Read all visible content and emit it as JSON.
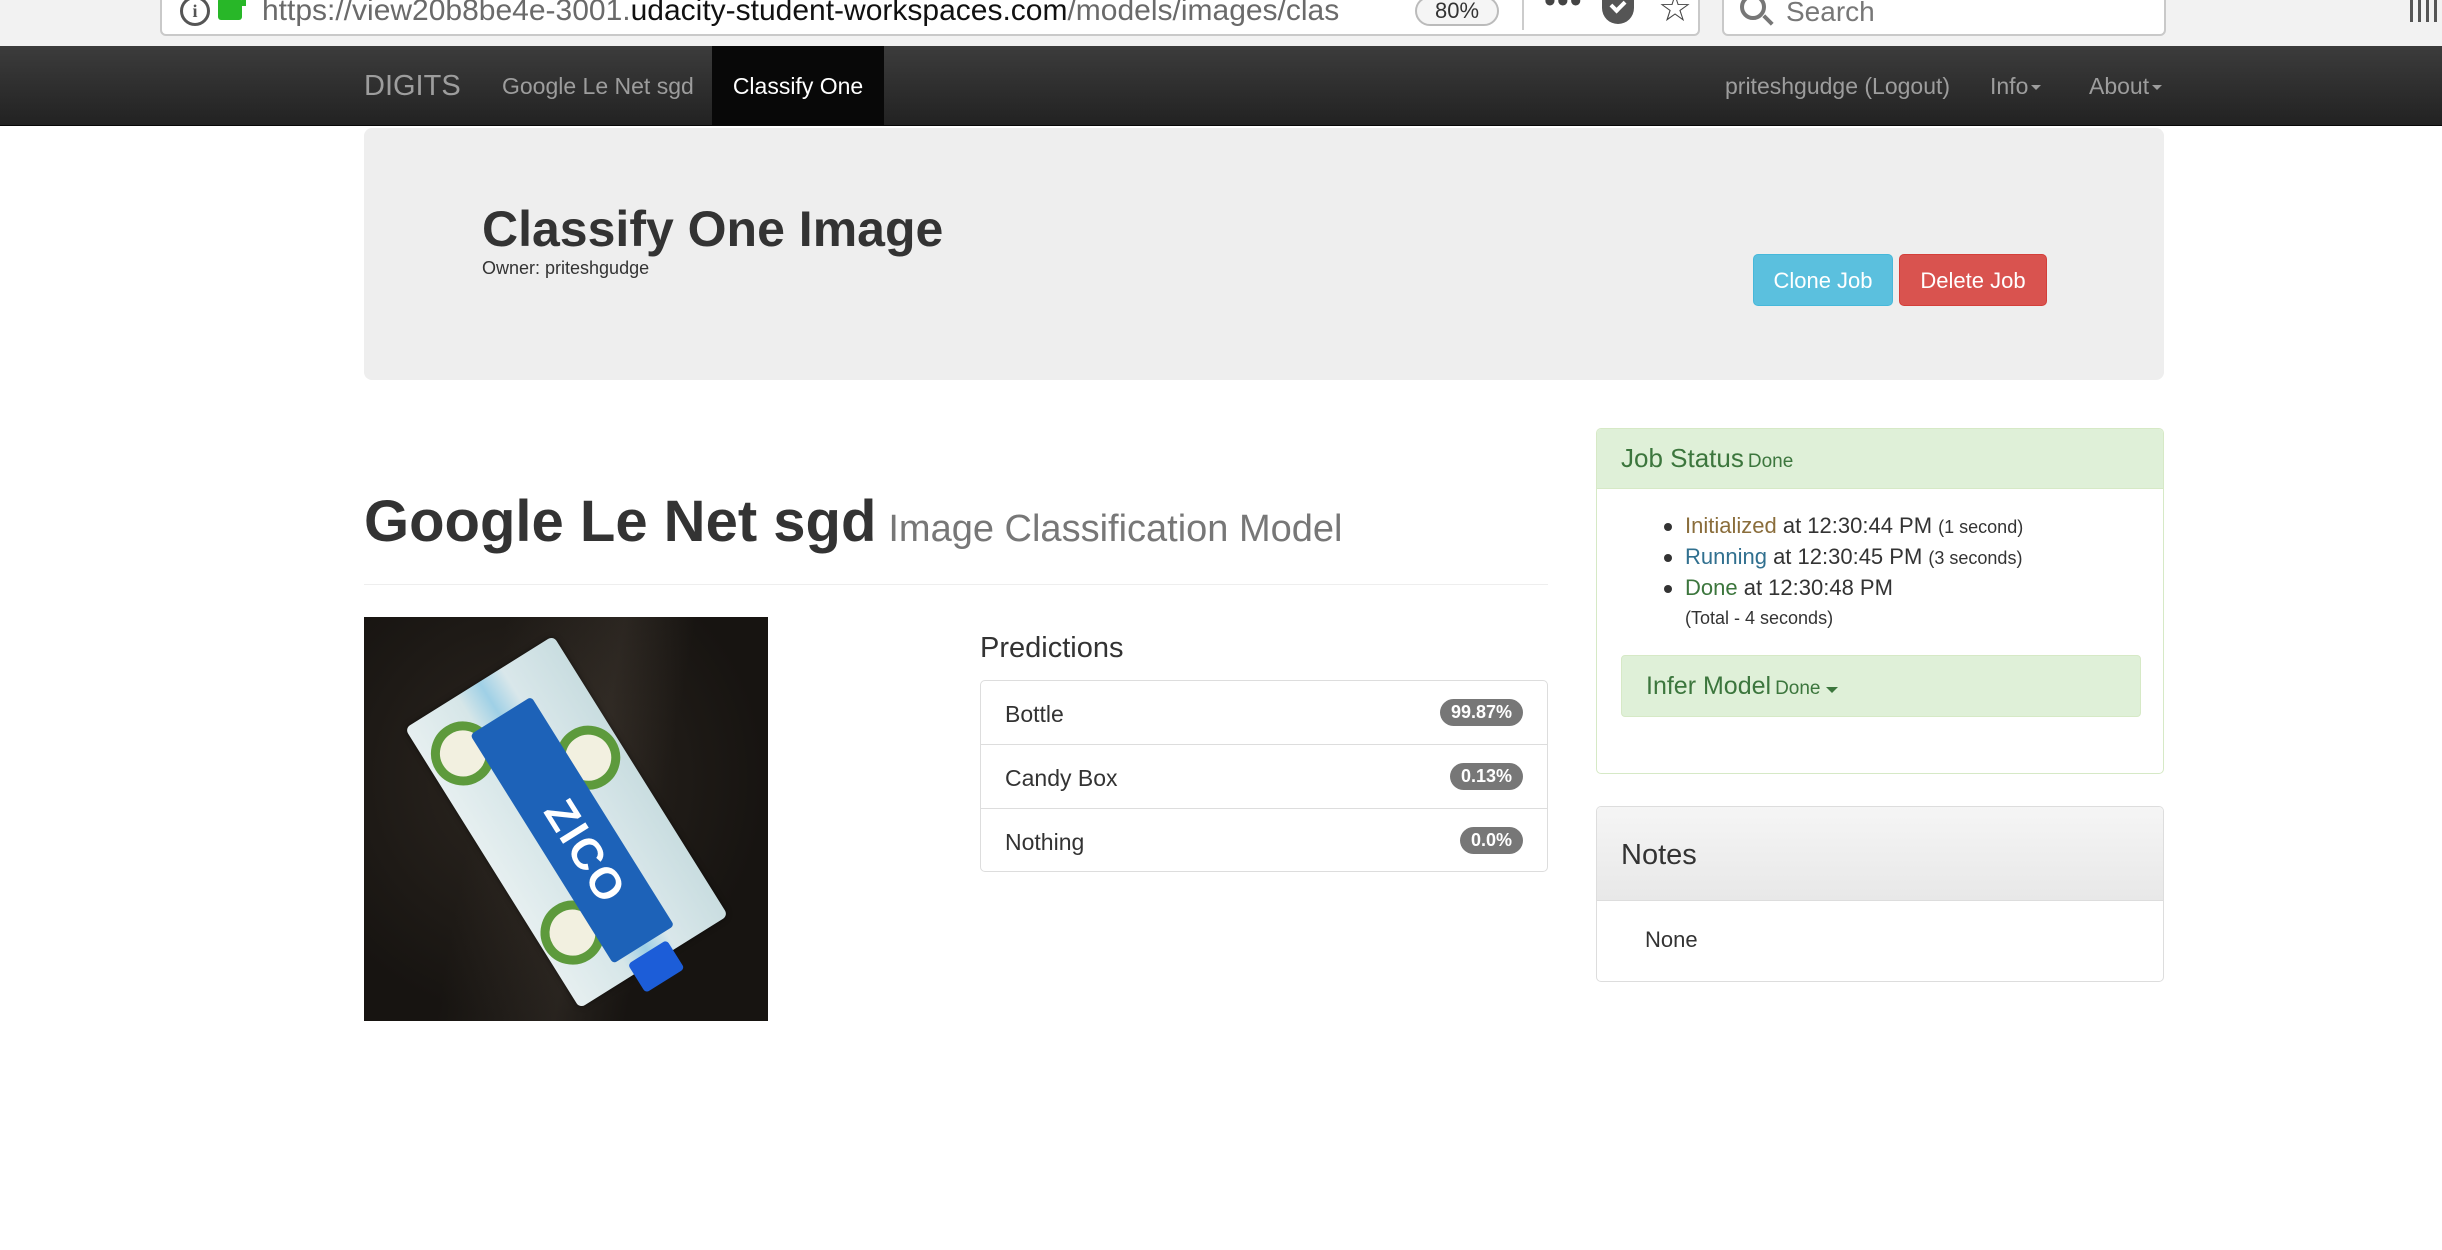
{
  "browser": {
    "url_prefix": "https://view20b8be4e-3001.",
    "url_domain": "udacity-student-workspaces.com",
    "url_path": "/models/images/clas",
    "zoom": "80%",
    "search_placeholder": "Search",
    "icons": [
      "info-icon",
      "lock-icon",
      "dots-icon",
      "pocket-icon",
      "star-icon",
      "search-icon",
      "library-icon"
    ]
  },
  "navbar": {
    "brand": "DIGITS",
    "left_items": [
      "Google Le Net sgd",
      "Classify One"
    ],
    "active": "Classify One",
    "user_logout": "priteshgudge (Logout)",
    "info": "Info",
    "about": "About"
  },
  "header": {
    "title": "Classify One Image",
    "owner": "Owner: priteshgudge",
    "clone_label": "Clone Job",
    "delete_label": "Delete Job"
  },
  "model": {
    "name": "Google Le Net sgd",
    "subtitle": "Image Classification Model"
  },
  "image": {
    "label_text": "ZICO"
  },
  "predictions": {
    "title": "Predictions",
    "rows": [
      {
        "label": "Bottle",
        "value": "99.87%"
      },
      {
        "label": "Candy Box",
        "value": "0.13%"
      },
      {
        "label": "Nothing",
        "value": "0.0%"
      }
    ]
  },
  "job_status": {
    "title": "Job Status",
    "state": "Done",
    "steps": [
      {
        "name": "Initialized",
        "time": " at 12:30:44 PM ",
        "duration": "(1 second)"
      },
      {
        "name": "Running",
        "time": " at 12:30:45 PM ",
        "duration": "(3 seconds)"
      },
      {
        "name": "Done",
        "time": " at 12:30:48 PM",
        "duration": ""
      }
    ],
    "total": "(Total - 4 seconds)",
    "infer_title": "Infer Model",
    "infer_state": "Done"
  },
  "notes": {
    "title": "Notes",
    "body": "None"
  },
  "colors": {
    "navbar_bg": "#222222",
    "clone_btn": "#5bc0de",
    "delete_btn": "#d9534f",
    "success_bg": "#dff0d8",
    "success_text": "#3c763d",
    "badge_bg": "#777777"
  }
}
